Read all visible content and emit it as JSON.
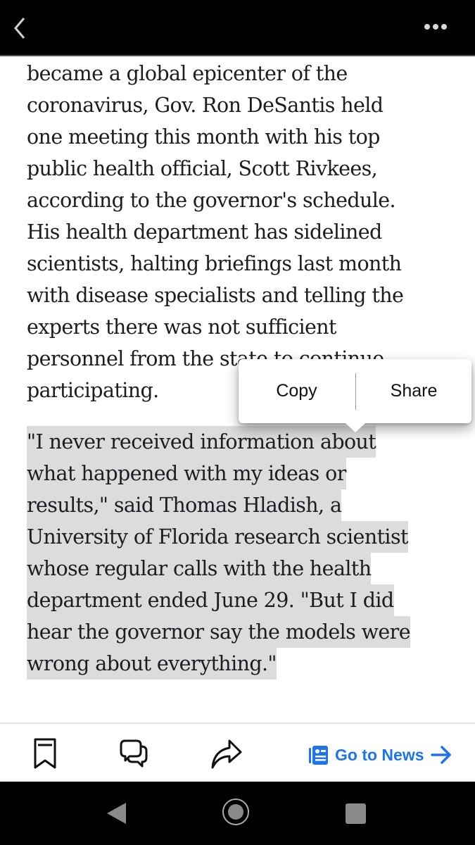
{
  "topbar": {
    "back_icon": "chevron-left-icon",
    "menu_icon": "more-horizontal-icon"
  },
  "article": {
    "paragraph1_lines": [
      "became a global epicenter of the",
      "coronavirus, Gov. Ron DeSantis held",
      "one meeting this month with his top",
      "public health official, Scott Rivkees,",
      "according to the governor's schedule.",
      "His health department has sidelined",
      "scientists, halting briefings last month",
      "with disease specialists and telling the",
      "experts there was not sufficient",
      "personnel from the state to continue",
      "participating."
    ],
    "paragraph2_selected_lines": [
      "\"I never received information about",
      "what happened with my ideas or",
      "results,\" said Thomas Hladish, a",
      "University of Florida research scientist",
      "whose regular calls with the health",
      "department ended June 29. \"But I did",
      "hear the governor say the models were",
      "wrong about everything.\""
    ]
  },
  "selection_popup": {
    "copy_label": "Copy",
    "share_label": "Share"
  },
  "bottombar": {
    "bookmark_icon": "bookmark-icon",
    "comments_icon": "comments-icon",
    "share_icon": "share-arrow-icon",
    "go_to_news_label": "Go to News",
    "accent_color": "#1f74e8"
  },
  "navbar": {
    "back": "nav-back-icon",
    "home": "nav-home-icon",
    "recents": "nav-recents-icon"
  }
}
